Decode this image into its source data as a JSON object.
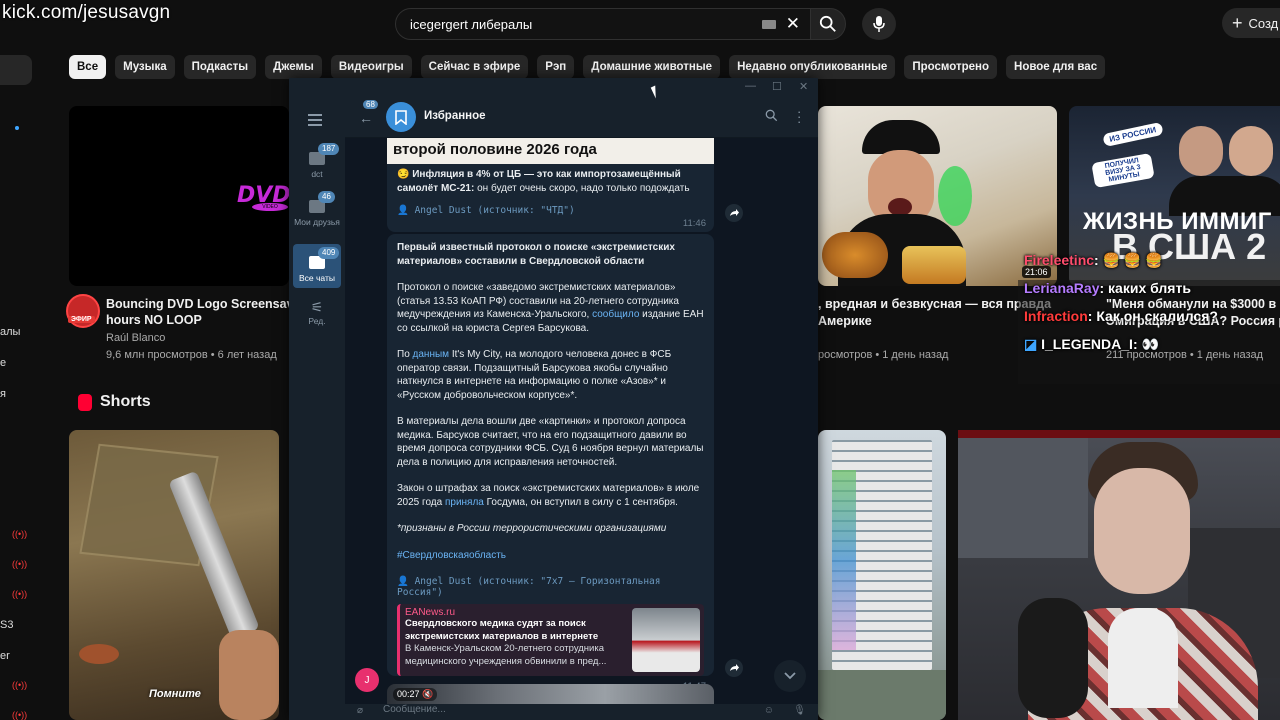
{
  "overlay": {
    "watermark": "kick.com/jesusavgn"
  },
  "youtube": {
    "search_query": "icegergert либералы",
    "create_label": "Созд",
    "chips": [
      "Все",
      "Музыка",
      "Подкасты",
      "Джемы",
      "Видеоигры",
      "Сейчас в эфире",
      "Рэп",
      "Домашние животные",
      "Недавно опубликованные",
      "Просмотрено",
      "Новое для вас"
    ],
    "sidebar_fragments": [
      "алы",
      "е",
      "я",
      "S3",
      "er",
      "r"
    ],
    "video1": {
      "title_l1": "Bouncing DVD Logo Screensaver 4",
      "title_l2": "hours NO LOOP",
      "channel": "Raúl Blanco",
      "meta": "9,6 млн просмотров • 6 лет назад",
      "avatar_label": "ЭФИР",
      "logo_text": "DVD",
      "logo_sub": "VIDEO"
    },
    "video2": {
      "title_l1": ", вредная и безвкусная — вся правда",
      "title_l2": "Америке",
      "meta": "росмотров • 1 день назад"
    },
    "video3": {
      "title_l1": "\"Меня обманули на $3000 в пе",
      "title_l2": "Эмиграция в США? Россия реаль",
      "meta": "211 просмотров • 1 день назад",
      "thumb_badge_l1": "ИЗ РОССИИ",
      "thumb_badge_l2": "ПОЛУЧИЛ ВИЗУ ЗА 3 МИНУТЫ",
      "thumb_title_l1": "ЖИЗНЬ ИММИГ",
      "thumb_title_l2": "В США 2",
      "duration": "21:06"
    },
    "shorts_title": "Shorts",
    "short1_caption": "Помните"
  },
  "stream_chat": [
    {
      "user": "Fireleetinc",
      "text": ": 🍔 🍔 🍔",
      "color": "#ff4d6d"
    },
    {
      "user": "LerianaRay",
      "text": ": каких блять",
      "color": "#b57cff"
    },
    {
      "user": "Infraction",
      "text": ": Как он скалился?",
      "color": "#ff3b3b"
    },
    {
      "user": "I_LEGENDA_I",
      "text": ": 👀",
      "color": "#ffffff"
    }
  ],
  "telegram": {
    "chat_name": "Избранное",
    "back_badge": "68",
    "folders": [
      {
        "label": "dct",
        "badge": "187"
      },
      {
        "label": "Мои друзья",
        "badge": "46"
      },
      {
        "label": "Все чаты",
        "badge": "409"
      },
      {
        "label": "Ред.",
        "badge": ""
      }
    ],
    "msg1": {
      "image_caption": "второй половине 2026 года",
      "text_bold": "Инфляция в 4% от ЦБ — это как импортозамещённый самолёт МС-21:",
      "text_rest": " он будет очень скоро, надо только подождать",
      "source": "Angel Dust (источник: \"ЧТД\")",
      "time": "11:46"
    },
    "msg2": {
      "headline": "Первый известный протокол о поиске «экстремистских материалов» составили в Свердловской области",
      "p1a": "Протокол о поиске «заведомо экстремистских материалов» (статья 13.53 КоАП РФ) составили на 20-летнего сотрудника медучреждения из Каменска-Уральского, ",
      "p1link": "сообщило",
      "p1b": " издание ЕАН со ссылкой на юриста Сергея Барсукова.",
      "p2a": "По ",
      "p2link": "данным",
      "p2b": " It's My City, на молодого человека донес в ФСБ оператор связи. Подзащитный Барсукова якобы случайно наткнулся в интернете на информацию о полке «Азов»* и «Русском добровольческом корпусе»*.",
      "p3": "В материалы дела вошли две «картинки» и протокол допроса медика. Барсуков считает, что на его подзащитного давили во время допроса сотрудники ФСБ. Суд 6 ноября вернул материалы дела в полицию для исправления неточностей.",
      "p4a": "Закон о штрафах за поиск «экстремистских материалов» в июле 2025 года ",
      "p4link": "приняла",
      "p4b": " Госдума, он вступил в силу с 1 сентября.",
      "p5": "*признаны в России террористическими организациями",
      "hashtag": "#Свердловскаяобласть",
      "source": "Angel Dust (источник: \"7х7 – Горизонтальная Россия\")",
      "preview_site": "EANews.ru",
      "preview_title": "Свердловского медика судят за поиск экстремистских материалов в интернете",
      "preview_desc": "В Каменск-Уральском 20-летнего сотрудника медицинского учреждения обвинили в пред...",
      "time": "11:47"
    },
    "msg3": {
      "video_time": "00:27",
      "avatar_letter": "J"
    },
    "input_placeholder": "Сообщение..."
  }
}
